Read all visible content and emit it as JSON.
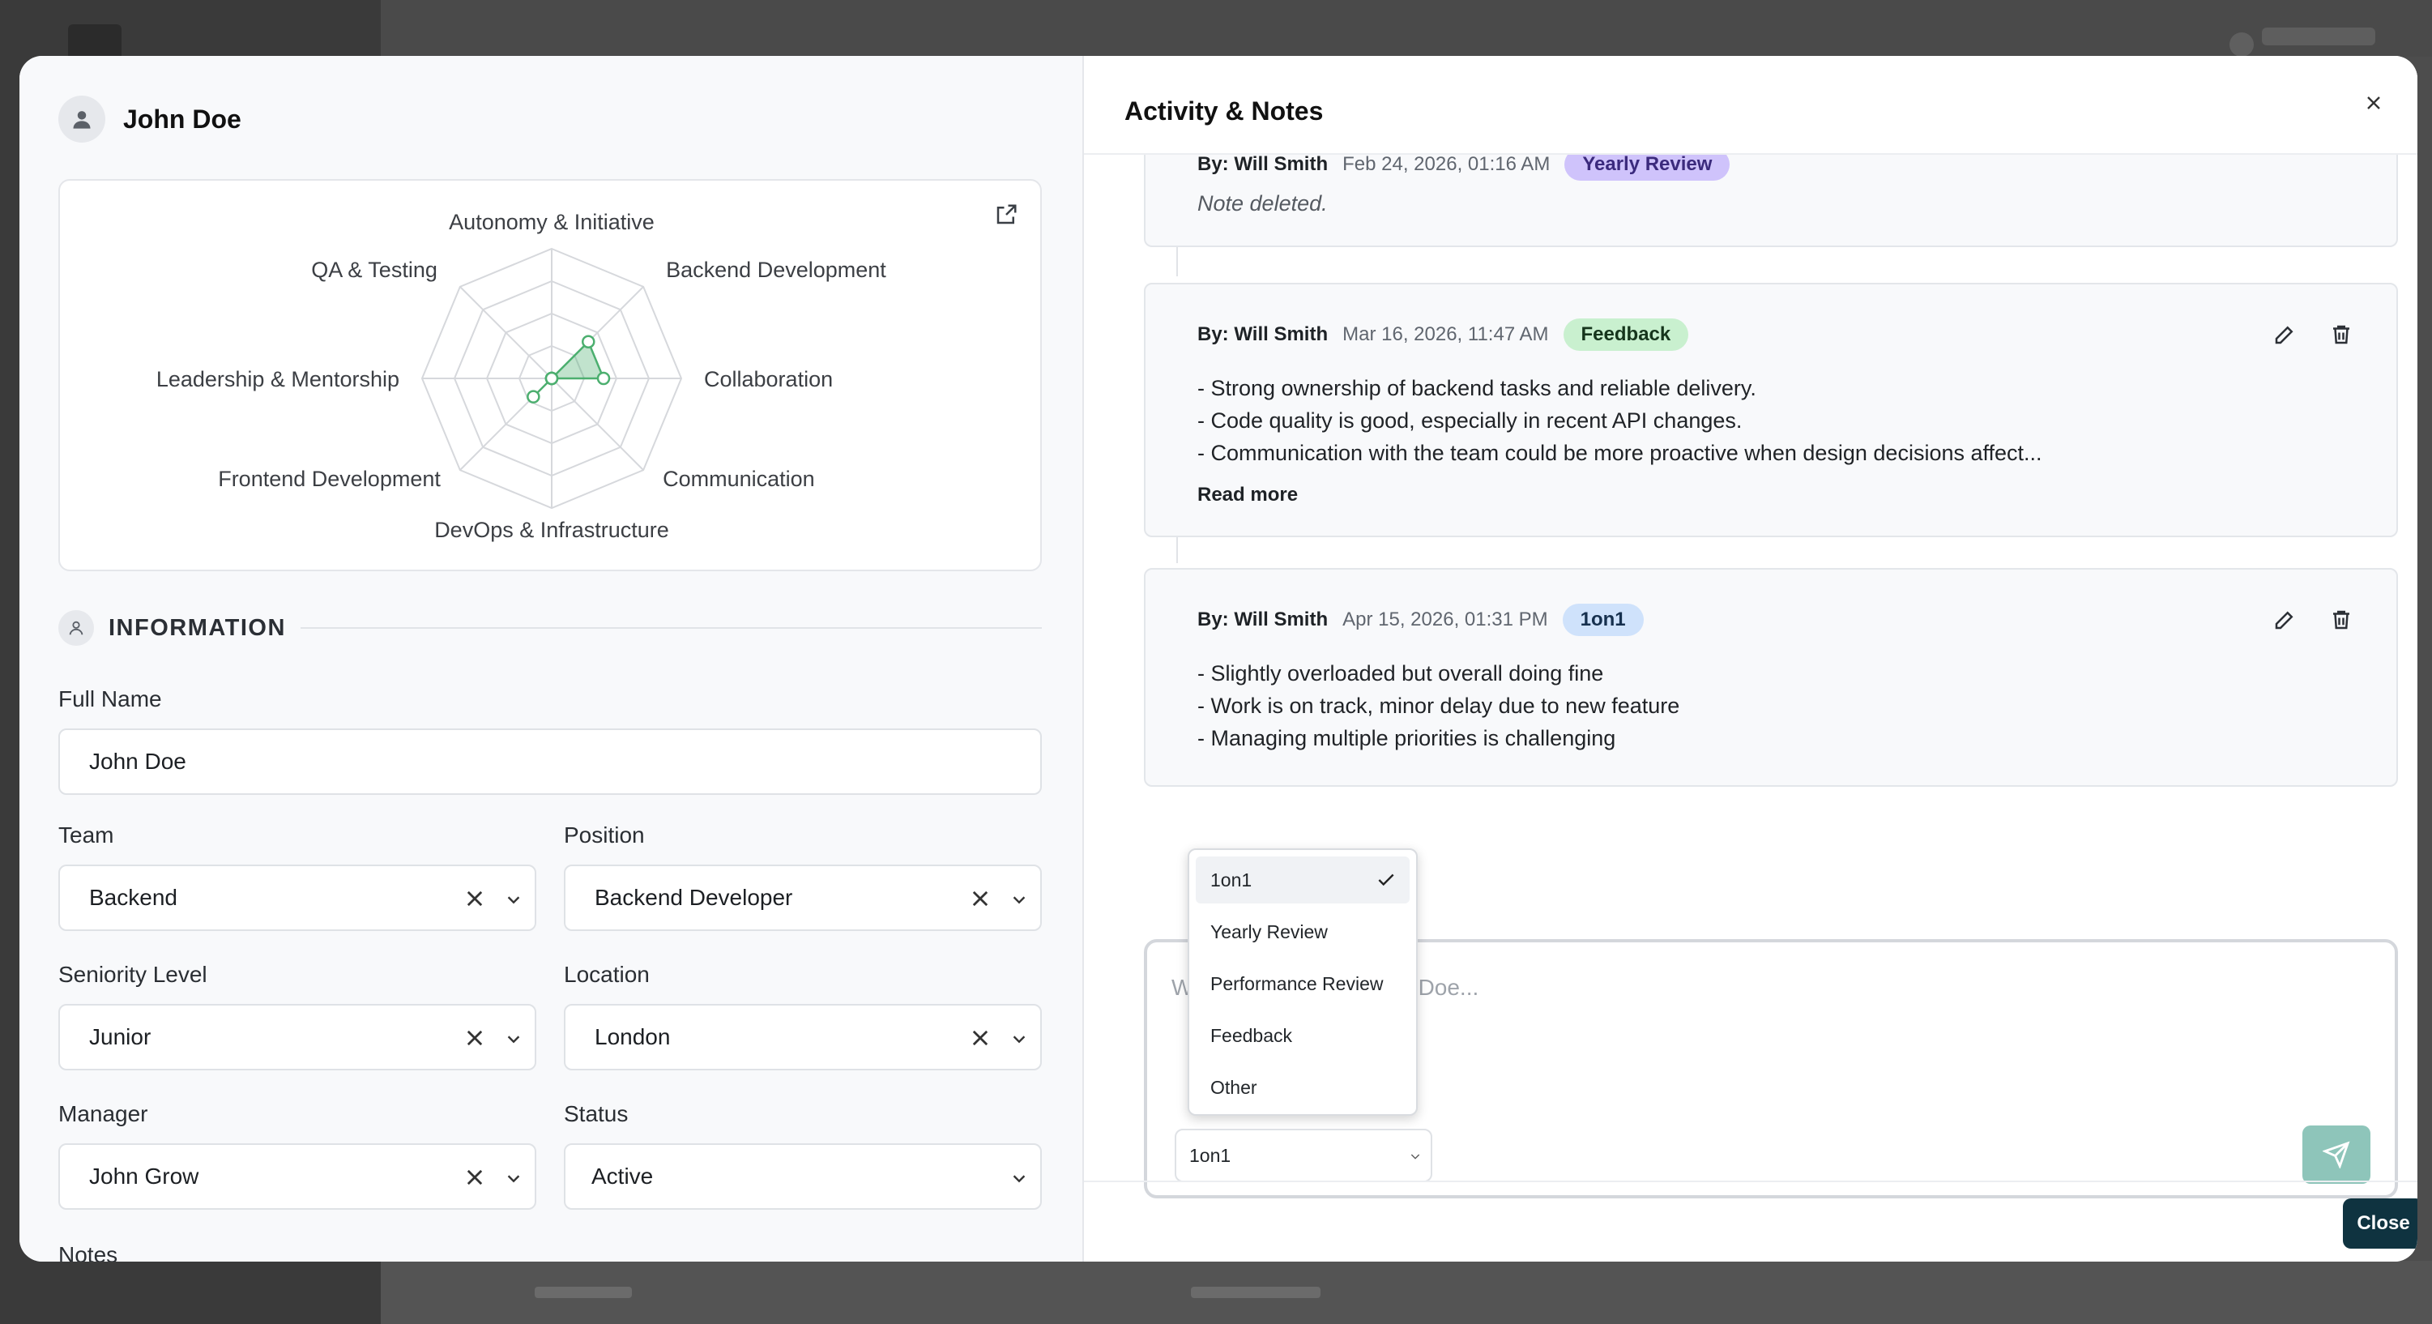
{
  "modal": {
    "person_name": "John Doe",
    "section_title": "INFORMATION",
    "radar": {
      "axes": [
        "Autonomy & Initiative",
        "Backend Development",
        "Collaboration",
        "Communication",
        "DevOps & Infrastructure",
        "Frontend Development",
        "Leadership & Mentorship",
        "QA & Testing"
      ],
      "values": [
        0,
        2,
        2,
        0,
        0,
        1,
        0,
        0
      ],
      "max": 5,
      "color": "#4caf6f"
    },
    "fields": {
      "full_name_label": "Full Name",
      "full_name": "John Doe",
      "team_label": "Team",
      "team": "Backend",
      "position_label": "Position",
      "position": "Backend Developer",
      "seniority_label": "Seniority Level",
      "seniority": "Junior",
      "location_label": "Location",
      "location": "London",
      "manager_label": "Manager",
      "manager": "John Grow",
      "status_label": "Status",
      "status": "Active",
      "notes_label": "Notes"
    },
    "activity": {
      "title": "Activity & Notes",
      "notes": [
        {
          "by": "By: Will Smith",
          "ts": "Feb 24, 2026, 01:16 AM",
          "tag": "Yearly Review",
          "body": [
            "Note deleted."
          ]
        },
        {
          "by": "By: Will Smith",
          "ts": "Mar 16, 2026, 11:47 AM",
          "tag": "Feedback",
          "body": [
            "- Strong ownership of backend tasks and reliable delivery.",
            "- Code quality is good, especially in recent API changes.",
            "- Communication with the team could be more proactive when design decisions affect..."
          ],
          "read_more": "Read more"
        },
        {
          "by": "By: Will Smith",
          "ts": "Apr 15, 2026, 01:31 PM",
          "tag": "1on1",
          "body": [
            "- Slightly overloaded but overall doing fine",
            "- Work is on track, minor delay due to new feature",
            "- Managing multiple priorities is challenging"
          ]
        }
      ],
      "composer_placeholder": "Write a note about John Doe...",
      "selected_type": "1on1",
      "type_options": [
        "1on1",
        "Yearly Review",
        "Performance Review",
        "Feedback",
        "Other"
      ]
    },
    "close_label": "Close"
  }
}
